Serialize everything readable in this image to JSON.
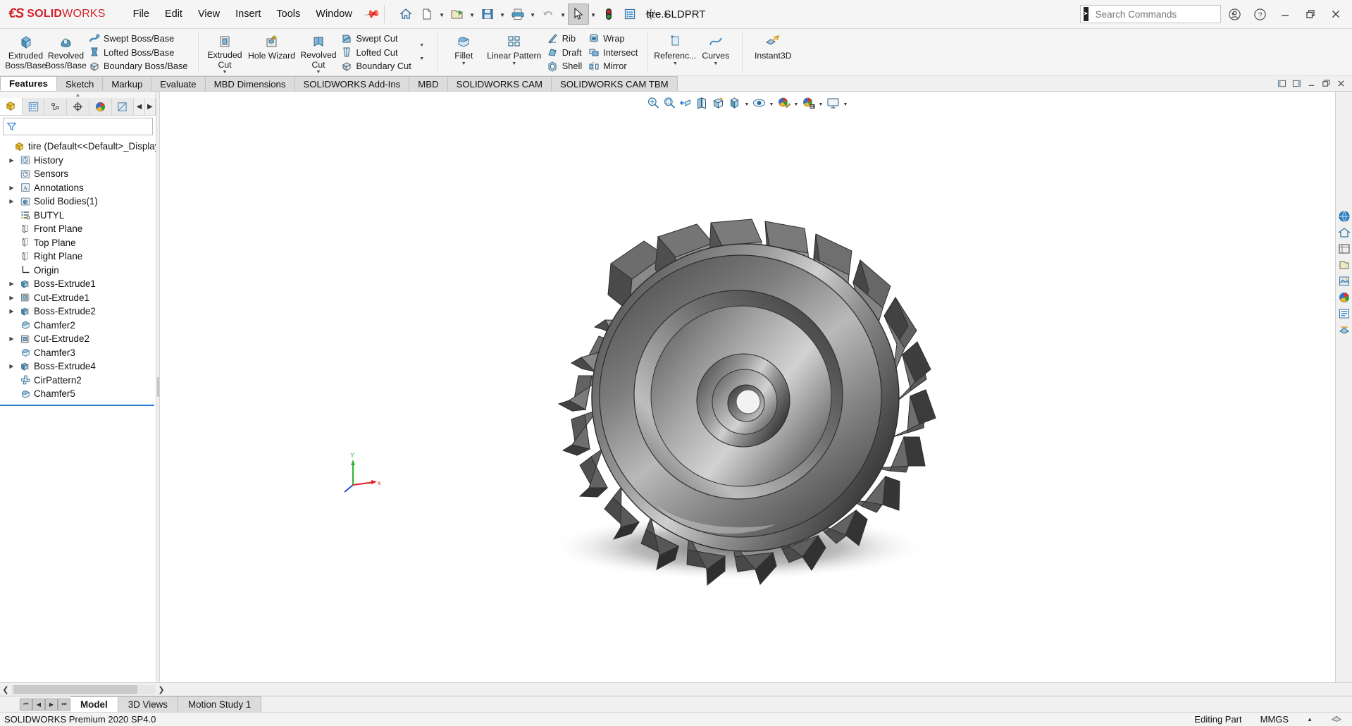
{
  "app": {
    "brand_bold": "SOLID",
    "brand_light": "WORKS",
    "document_title": "tire.SLDPRT",
    "status_product": "SOLIDWORKS Premium 2020 SP4.0",
    "status_mode": "Editing Part",
    "status_units": "MMGS",
    "accent_red": "#d12229",
    "accent_blue": "#2b7fd4"
  },
  "menu": {
    "items": [
      "File",
      "Edit",
      "View",
      "Insert",
      "Tools",
      "Window"
    ],
    "pin": "pin-icon"
  },
  "quick_access": {
    "buttons": [
      {
        "name": "home-icon",
        "label": "Home"
      },
      {
        "name": "new-document-icon",
        "label": "New"
      },
      {
        "name": "open-document-icon",
        "label": "Open"
      },
      {
        "name": "save-icon",
        "label": "Save"
      },
      {
        "name": "print-icon",
        "label": "Print"
      },
      {
        "name": "undo-icon",
        "label": "Undo"
      },
      {
        "name": "select-cursor-icon",
        "label": "Select"
      },
      {
        "name": "rebuild-icon",
        "label": "Rebuild"
      },
      {
        "name": "file-properties-icon",
        "label": "File Properties"
      },
      {
        "name": "options-gear-icon",
        "label": "Options"
      }
    ]
  },
  "search": {
    "placeholder": "Search Commands",
    "icon": "search-icon"
  },
  "window_controls": {
    "account": "user-account-icon",
    "help": "help-icon",
    "minimize": "minimize-icon",
    "restore": "restore-icon",
    "close": "close-icon"
  },
  "ribbon": {
    "groups": [
      {
        "big": [
          {
            "label_top": "Extruded",
            "label_bottom": "Boss/Base",
            "icon": "extruded-boss-icon"
          },
          {
            "label_top": "Revolved",
            "label_bottom": "Boss/Base",
            "icon": "revolved-boss-icon"
          }
        ],
        "small": [
          {
            "label": "Swept Boss/Base",
            "icon": "swept-boss-icon"
          },
          {
            "label": "Lofted Boss/Base",
            "icon": "lofted-boss-icon"
          },
          {
            "label": "Boundary Boss/Base",
            "icon": "boundary-boss-icon"
          }
        ]
      },
      {
        "big": [
          {
            "label_top": "Extruded",
            "label_bottom": "Cut",
            "icon": "extruded-cut-icon",
            "has_caret": true
          },
          {
            "label_top": "Hole Wizard",
            "label_bottom": "",
            "icon": "hole-wizard-icon"
          },
          {
            "label_top": "Revolved",
            "label_bottom": "Cut",
            "icon": "revolved-cut-icon"
          }
        ],
        "small": [
          {
            "label": "Swept Cut",
            "icon": "swept-cut-icon"
          },
          {
            "label": "Lofted Cut",
            "icon": "lofted-cut-icon"
          },
          {
            "label": "Boundary Cut",
            "icon": "boundary-cut-icon"
          }
        ]
      },
      {
        "big": [
          {
            "label_top": "Fillet",
            "label_bottom": "",
            "icon": "fillet-icon",
            "has_caret": true
          },
          {
            "label_top": "Linear Pattern",
            "label_bottom": "",
            "icon": "linear-pattern-icon",
            "has_caret": true
          }
        ],
        "small": [
          {
            "label": "Rib",
            "icon": "rib-icon"
          },
          {
            "label": "Draft",
            "icon": "draft-icon"
          },
          {
            "label": "Shell",
            "icon": "shell-icon"
          }
        ],
        "small2": [
          {
            "label": "Wrap",
            "icon": "wrap-icon"
          },
          {
            "label": "Intersect",
            "icon": "intersect-icon"
          },
          {
            "label": "Mirror",
            "icon": "mirror-icon"
          }
        ]
      },
      {
        "big": [
          {
            "label_top": "Referenc...",
            "label_bottom": "",
            "icon": "reference-geometry-icon",
            "has_caret": true
          },
          {
            "label_top": "Curves",
            "label_bottom": "",
            "icon": "curves-icon",
            "has_caret": true
          }
        ]
      },
      {
        "big": [
          {
            "label_top": "Instant3D",
            "label_bottom": "",
            "icon": "instant3d-icon"
          }
        ]
      }
    ]
  },
  "tabs": {
    "items": [
      {
        "label": "Features",
        "active": true
      },
      {
        "label": "Sketch",
        "active": false
      },
      {
        "label": "Markup",
        "active": false
      },
      {
        "label": "Evaluate",
        "active": false
      },
      {
        "label": "MBD Dimensions",
        "active": false
      },
      {
        "label": "SOLIDWORKS Add-Ins",
        "active": false
      },
      {
        "label": "MBD",
        "active": false
      },
      {
        "label": "SOLIDWORKS CAM",
        "active": false
      },
      {
        "label": "SOLIDWORKS CAM TBM",
        "active": false
      }
    ],
    "right_controls": [
      {
        "name": "restore-panel-icon"
      },
      {
        "name": "collapse-panel-icon"
      },
      {
        "name": "minimize-doc-icon"
      },
      {
        "name": "restore-doc-icon"
      },
      {
        "name": "close-doc-icon"
      }
    ]
  },
  "left_panel": {
    "tabs": [
      {
        "name": "feature-manager-tab",
        "icon": "feature-tree-icon",
        "active": true
      },
      {
        "name": "property-manager-tab",
        "icon": "property-list-icon",
        "active": false
      },
      {
        "name": "configuration-manager-tab",
        "icon": "configuration-icon",
        "active": false
      },
      {
        "name": "dimxpert-manager-tab",
        "icon": "dimxpert-icon",
        "active": false
      },
      {
        "name": "display-manager-tab",
        "icon": "display-palette-icon",
        "active": false
      },
      {
        "name": "extra-manager-tab",
        "icon": "render-icon",
        "active": false
      }
    ],
    "filter_icon": "filter-funnel-icon",
    "tree": [
      {
        "label": "tire  (Default<<Default>_Display Sta",
        "icon": "part-icon",
        "expandable": false,
        "indent": 0,
        "root": true
      },
      {
        "label": "History",
        "icon": "history-icon",
        "expandable": true,
        "indent": 1
      },
      {
        "label": "Sensors",
        "icon": "sensors-icon",
        "expandable": false,
        "indent": 1
      },
      {
        "label": "Annotations",
        "icon": "annotations-icon",
        "expandable": true,
        "indent": 1
      },
      {
        "label": "Solid Bodies(1)",
        "icon": "solid-bodies-icon",
        "expandable": true,
        "indent": 1
      },
      {
        "label": "BUTYL",
        "icon": "material-icon",
        "expandable": false,
        "indent": 1
      },
      {
        "label": "Front Plane",
        "icon": "plane-icon",
        "expandable": false,
        "indent": 1
      },
      {
        "label": "Top Plane",
        "icon": "plane-icon",
        "expandable": false,
        "indent": 1
      },
      {
        "label": "Right Plane",
        "icon": "plane-icon",
        "expandable": false,
        "indent": 1
      },
      {
        "label": "Origin",
        "icon": "origin-icon",
        "expandable": false,
        "indent": 1
      },
      {
        "label": "Boss-Extrude1",
        "icon": "boss-extrude-icon",
        "expandable": true,
        "indent": 1
      },
      {
        "label": "Cut-Extrude1",
        "icon": "cut-extrude-icon",
        "expandable": true,
        "indent": 1
      },
      {
        "label": "Boss-Extrude2",
        "icon": "boss-extrude-icon",
        "expandable": true,
        "indent": 1
      },
      {
        "label": "Chamfer2",
        "icon": "chamfer-icon",
        "expandable": false,
        "indent": 1
      },
      {
        "label": "Cut-Extrude2",
        "icon": "cut-extrude-icon",
        "expandable": true,
        "indent": 1
      },
      {
        "label": "Chamfer3",
        "icon": "chamfer-icon",
        "expandable": false,
        "indent": 1
      },
      {
        "label": "Boss-Extrude4",
        "icon": "boss-extrude-icon",
        "expandable": true,
        "indent": 1
      },
      {
        "label": "CirPattern2",
        "icon": "circular-pattern-icon",
        "expandable": false,
        "indent": 1
      },
      {
        "label": "Chamfer5",
        "icon": "chamfer-icon",
        "expandable": false,
        "indent": 1
      }
    ]
  },
  "view_toolbar": {
    "buttons": [
      {
        "name": "zoom-to-fit-icon",
        "caret": false
      },
      {
        "name": "zoom-to-area-icon",
        "caret": false
      },
      {
        "name": "previous-view-icon",
        "caret": false
      },
      {
        "name": "section-view-icon",
        "caret": false
      },
      {
        "name": "view-orientation-icon",
        "caret": false
      },
      {
        "name": "display-style-icon",
        "caret": true
      },
      {
        "name": "hide-show-items-icon",
        "caret": true
      },
      {
        "name": "edit-appearance-icon",
        "caret": true
      },
      {
        "name": "apply-scene-icon",
        "caret": true
      },
      {
        "name": "view-settings-icon",
        "caret": true
      }
    ]
  },
  "right_bar": {
    "buttons": [
      {
        "name": "solidworks-resources-icon"
      },
      {
        "name": "design-library-icon"
      },
      {
        "name": "file-explorer-icon"
      },
      {
        "name": "view-palette-icon"
      },
      {
        "name": "appearances-scenes-icon"
      },
      {
        "name": "custom-properties-icon"
      },
      {
        "name": "solidworks-forum-icon"
      },
      {
        "name": "pmi-icon"
      }
    ]
  },
  "triad": {
    "x_label": "x",
    "y_label": "Y"
  },
  "bottom": {
    "nav_buttons": [
      "first-tab-icon",
      "prev-tab-icon",
      "next-tab-icon",
      "last-tab-icon"
    ],
    "tabs": [
      {
        "label": "Model",
        "active": true
      },
      {
        "label": "3D Views",
        "active": false
      },
      {
        "label": "Motion Study 1",
        "active": false
      }
    ]
  },
  "model": {
    "name": "tire-3d-model",
    "description": "Shaded gear-like tire part with radial tread blocks, central hub bore and chamfered faces"
  }
}
